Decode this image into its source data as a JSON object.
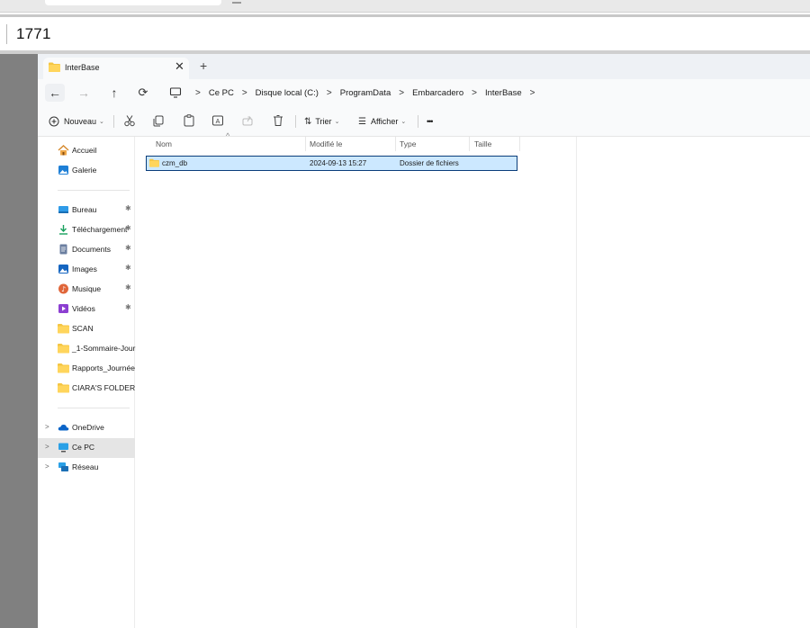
{
  "outer": {
    "number": "1771"
  },
  "tab": {
    "title": "InterBase",
    "close": "✕",
    "new_tab": "+"
  },
  "nav": {
    "back": "←",
    "forward": "→",
    "up": "↑",
    "refresh": "⟳",
    "breadcrumbs": [
      "Ce PC",
      "Disque local (C:)",
      "ProgramData",
      "Embarcadero",
      "InterBase"
    ],
    "separator": ">"
  },
  "commands": {
    "new_label": "Nouveau",
    "sort_label": "Trier",
    "view_label": "Afficher",
    "more": "•••"
  },
  "sidebar": {
    "top": [
      {
        "label": "Accueil",
        "icon": "home-icon"
      },
      {
        "label": "Galerie",
        "icon": "gallery-icon"
      }
    ],
    "quick": [
      {
        "label": "Bureau",
        "icon": "desktop-icon",
        "pinned": true
      },
      {
        "label": "Téléchargement",
        "icon": "download-icon",
        "pinned": true
      },
      {
        "label": "Documents",
        "icon": "documents-icon",
        "pinned": true
      },
      {
        "label": "Images",
        "icon": "images-icon",
        "pinned": true
      },
      {
        "label": "Musique",
        "icon": "music-icon",
        "pinned": true
      },
      {
        "label": "Vidéos",
        "icon": "videos-icon",
        "pinned": true
      },
      {
        "label": "SCAN",
        "icon": "folder-icon",
        "pinned": false
      },
      {
        "label": "_1-Sommaire-Journ",
        "icon": "folder-icon",
        "pinned": false
      },
      {
        "label": "Rapports_Journée",
        "icon": "folder-icon",
        "pinned": false
      },
      {
        "label": "CIARA'S FOLDER",
        "icon": "folder-icon",
        "pinned": false
      }
    ],
    "locations": [
      {
        "label": "OneDrive",
        "icon": "cloud-icon"
      },
      {
        "label": "Ce PC",
        "icon": "pc-icon",
        "selected": true
      },
      {
        "label": "Réseau",
        "icon": "network-icon"
      }
    ],
    "pin_glyph": "📌",
    "expand_glyph": ">"
  },
  "columns": {
    "name": "Nom",
    "modified": "Modifié le",
    "type": "Type",
    "size": "Taille"
  },
  "files": [
    {
      "name": "czm_db",
      "modified": "2024-09-13 15:27",
      "type": "Dossier de fichiers",
      "size": ""
    }
  ],
  "colors": {
    "folder": "#f4c542",
    "selection": "#cce8ff",
    "selection_border": "#0a3d7a",
    "accent": "#0067c0"
  }
}
